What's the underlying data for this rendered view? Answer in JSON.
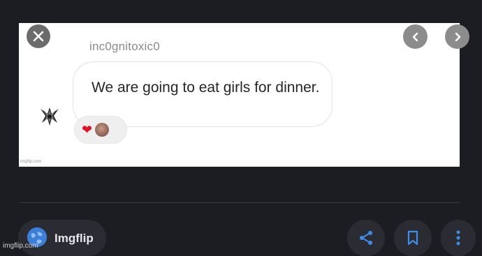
{
  "post": {
    "username": "inc0gnitoxic0",
    "message": "We are going to eat girls for dinner.",
    "reactions": [
      "heart-emoji",
      "face-emoji"
    ],
    "watermark": "imgflip.com"
  },
  "viewer": {
    "close_icon": "close-icon",
    "prev_icon": "chevron-left-icon",
    "next_icon": "chevron-right-icon"
  },
  "footer": {
    "brand_label": "Imgflip",
    "corner_watermark": "imgflip.com",
    "share_icon": "share-icon",
    "bookmark_icon": "bookmark-icon",
    "more_icon": "more-vertical-icon"
  },
  "colors": {
    "background": "#1c1d23",
    "card": "#ffffff",
    "pill": "#2b2c33",
    "accent_blue": "#3d7fd6",
    "heart": "#e0152a"
  }
}
